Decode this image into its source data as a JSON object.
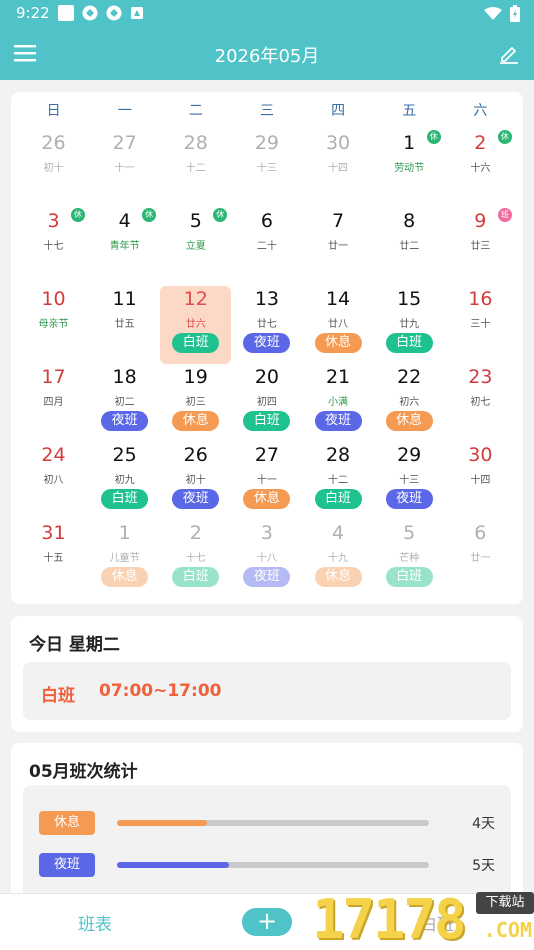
{
  "status": {
    "time": "9:22"
  },
  "appbar": {
    "title": "2026年05月"
  },
  "weekdays": [
    "日",
    "一",
    "二",
    "三",
    "四",
    "五",
    "六"
  ],
  "calendar": [
    [
      {
        "d": "26",
        "l": "初十",
        "g": true
      },
      {
        "d": "27",
        "l": "十一",
        "g": true
      },
      {
        "d": "28",
        "l": "十二",
        "g": true
      },
      {
        "d": "29",
        "l": "十三",
        "g": true
      },
      {
        "d": "30",
        "l": "十四",
        "g": true
      },
      {
        "d": "1",
        "l": "劳动节",
        "lg": true,
        "badge": "休"
      },
      {
        "d": "2",
        "l": "十六",
        "red": true,
        "badge": "休"
      }
    ],
    [
      {
        "d": "3",
        "l": "十七",
        "red": true,
        "badge": "休"
      },
      {
        "d": "4",
        "l": "青年节",
        "lg": true,
        "badge": "休"
      },
      {
        "d": "5",
        "l": "立夏",
        "lg": true,
        "badge": "休"
      },
      {
        "d": "6",
        "l": "二十"
      },
      {
        "d": "7",
        "l": "廿一"
      },
      {
        "d": "8",
        "l": "廿二"
      },
      {
        "d": "9",
        "l": "廿三",
        "red": true,
        "badge": "班",
        "ban": true
      }
    ],
    [
      {
        "d": "10",
        "l": "母亲节",
        "lg": true,
        "red": true
      },
      {
        "d": "11",
        "l": "廿五"
      },
      {
        "d": "12",
        "l": "廿六",
        "today": true,
        "s": "白班",
        "sc": "bai"
      },
      {
        "d": "13",
        "l": "廿七",
        "s": "夜班",
        "sc": "ye"
      },
      {
        "d": "14",
        "l": "廿八",
        "s": "休息",
        "sc": "xiu"
      },
      {
        "d": "15",
        "l": "廿九",
        "s": "白班",
        "sc": "bai"
      },
      {
        "d": "16",
        "l": "三十",
        "red": true
      }
    ],
    [
      {
        "d": "17",
        "l": "四月",
        "red": true
      },
      {
        "d": "18",
        "l": "初二",
        "s": "夜班",
        "sc": "ye"
      },
      {
        "d": "19",
        "l": "初三",
        "s": "休息",
        "sc": "xiu"
      },
      {
        "d": "20",
        "l": "初四",
        "s": "白班",
        "sc": "bai"
      },
      {
        "d": "21",
        "l": "小满",
        "lg": true,
        "s": "夜班",
        "sc": "ye"
      },
      {
        "d": "22",
        "l": "初六",
        "s": "休息",
        "sc": "xiu"
      },
      {
        "d": "23",
        "l": "初七",
        "red": true
      }
    ],
    [
      {
        "d": "24",
        "l": "初八",
        "red": true
      },
      {
        "d": "25",
        "l": "初九",
        "s": "白班",
        "sc": "bai"
      },
      {
        "d": "26",
        "l": "初十",
        "s": "夜班",
        "sc": "ye"
      },
      {
        "d": "27",
        "l": "十一",
        "s": "休息",
        "sc": "xiu"
      },
      {
        "d": "28",
        "l": "十二",
        "s": "白班",
        "sc": "bai"
      },
      {
        "d": "29",
        "l": "十三",
        "s": "夜班",
        "sc": "ye"
      },
      {
        "d": "30",
        "l": "十四",
        "red": true
      }
    ],
    [
      {
        "d": "31",
        "l": "十五",
        "red": true
      },
      {
        "d": "1",
        "l": "儿童节",
        "g": true,
        "s": "休息",
        "sc": "xiu",
        "f": true
      },
      {
        "d": "2",
        "l": "十七",
        "g": true,
        "s": "白班",
        "sc": "bai",
        "f": true
      },
      {
        "d": "3",
        "l": "十八",
        "g": true,
        "s": "夜班",
        "sc": "ye",
        "f": true
      },
      {
        "d": "4",
        "l": "十九",
        "g": true,
        "s": "休息",
        "sc": "xiu",
        "f": true
      },
      {
        "d": "5",
        "l": "芒种",
        "g": true,
        "s": "白班",
        "sc": "bai",
        "f": true
      },
      {
        "d": "6",
        "l": "廿一",
        "g": true
      }
    ]
  ],
  "today": {
    "heading": "今日 星期二",
    "shift": "白班",
    "hours": "07:00~17:00"
  },
  "stats": {
    "heading": "05月班次统计",
    "rows": [
      {
        "label": "休息",
        "count": "4天",
        "fraction": 0.29,
        "color": "#f59a53"
      },
      {
        "label": "夜班",
        "count": "5天",
        "fraction": 0.36,
        "color": "#5a67e6"
      }
    ]
  },
  "bottom": {
    "tab_schedule": "班表",
    "tab_other": "白班"
  },
  "watermark": {
    "digits": "17178",
    "download": "下载站",
    "domain": ".COM"
  }
}
